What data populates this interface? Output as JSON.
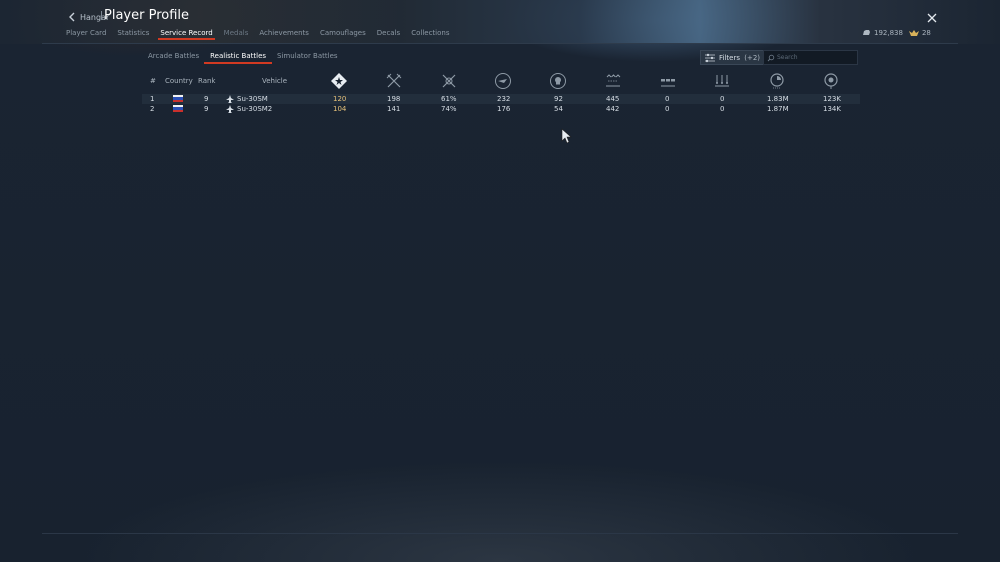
{
  "header": {
    "back_label": "Hangar",
    "separator": "|",
    "title": "Player Profile",
    "tabs": [
      {
        "label": "Player Card"
      },
      {
        "label": "Statistics"
      },
      {
        "label": "Service Record"
      },
      {
        "label": "Medals"
      },
      {
        "label": "Achievements"
      },
      {
        "label": "Camouflages"
      },
      {
        "label": "Decals"
      },
      {
        "label": "Collections"
      }
    ],
    "active_tab": "Service Record",
    "silver_lions": "192,838",
    "golden_eagles": "28"
  },
  "subtabs": [
    {
      "label": "Arcade Battles"
    },
    {
      "label": "Realistic Battles"
    },
    {
      "label": "Simulator Battles"
    }
  ],
  "active_subtab": "Realistic Battles",
  "filters": {
    "label": "Filters",
    "count": "(+2)"
  },
  "search": {
    "placeholder": "Search"
  },
  "table": {
    "columns": {
      "num": "#",
      "country": "Country",
      "rank": "Rank",
      "vehicle": "Vehicle"
    },
    "stat_icons": [
      "battles-icon",
      "victories-icon",
      "win-rate-icon",
      "respawns-icon",
      "deaths-icon",
      "air-kills-icon",
      "ground-kills-icon",
      "naval-kills-icon",
      "experience-icon",
      "lions-icon"
    ],
    "rows": [
      {
        "num": "1",
        "country": "russia",
        "rank": "9",
        "vehicle": "Su-30SM",
        "stats": [
          "120",
          "198",
          "61%",
          "232",
          "92",
          "445",
          "0",
          "0",
          "1.83M",
          "123K"
        ]
      },
      {
        "num": "2",
        "country": "russia",
        "rank": "9",
        "vehicle": "Su-30SM2",
        "stats": [
          "104",
          "141",
          "74%",
          "176",
          "54",
          "442",
          "0",
          "0",
          "1.87M",
          "134K"
        ]
      }
    ]
  },
  "colors": {
    "accent": "#d23a22",
    "gold": "#e6c27a",
    "background": "#18222f"
  }
}
